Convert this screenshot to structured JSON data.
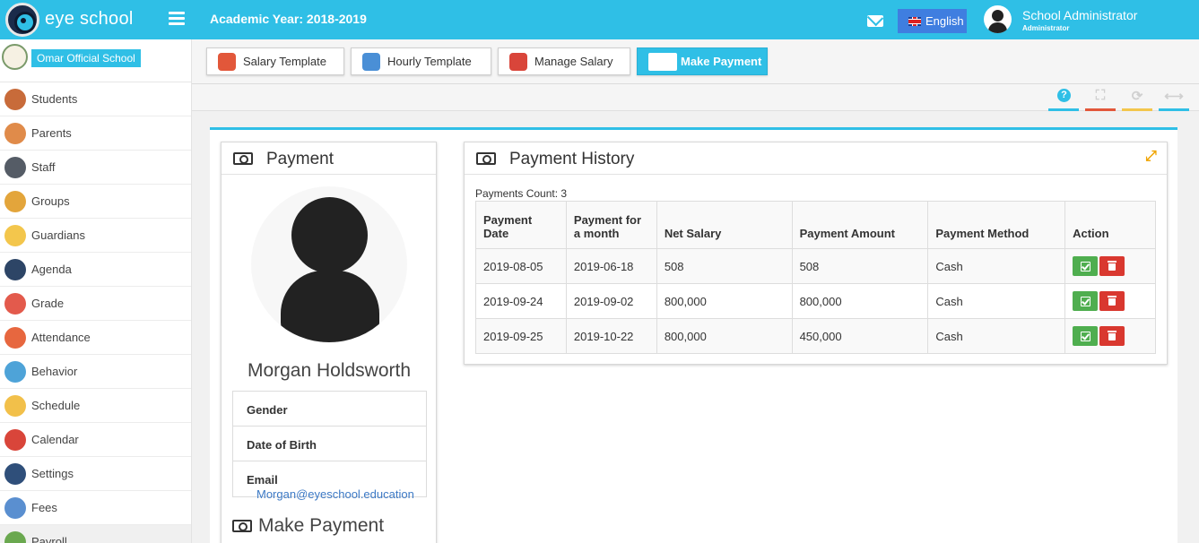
{
  "header": {
    "brand": "eye school",
    "academic_year": "Academic Year: 2018-2019",
    "language": "English",
    "user_name": "School Administrator",
    "user_role": "Administrator"
  },
  "sidebar": {
    "school_name": "Omar Official School",
    "items": [
      {
        "label": "Students",
        "icon": "students-icon",
        "color": "#c86b3a"
      },
      {
        "label": "Parents",
        "icon": "parents-icon",
        "color": "#e08b4a"
      },
      {
        "label": "Staff",
        "icon": "staff-icon",
        "color": "#555c66"
      },
      {
        "label": "Groups",
        "icon": "groups-icon",
        "color": "#e3a53b"
      },
      {
        "label": "Guardians",
        "icon": "guardians-icon",
        "color": "#f3c64c"
      },
      {
        "label": "Agenda",
        "icon": "agenda-icon",
        "color": "#2d4566"
      },
      {
        "label": "Grade",
        "icon": "grade-icon",
        "color": "#e35a4c"
      },
      {
        "label": "Attendance",
        "icon": "attendance-icon",
        "color": "#e7673f"
      },
      {
        "label": "Behavior",
        "icon": "behavior-icon",
        "color": "#4ea3d8"
      },
      {
        "label": "Schedule",
        "icon": "schedule-icon",
        "color": "#f2c04a"
      },
      {
        "label": "Calendar",
        "icon": "calendar-icon",
        "color": "#d9453a"
      },
      {
        "label": "Settings",
        "icon": "settings-icon",
        "color": "#2f4f7a"
      },
      {
        "label": "Fees",
        "icon": "fees-icon",
        "color": "#5a8fd0"
      },
      {
        "label": "Payroll",
        "icon": "payroll-icon",
        "color": "#6aa84f"
      }
    ]
  },
  "tabs": [
    {
      "label": "Salary Template",
      "icon": "salary-template-icon",
      "color": "#e2573a"
    },
    {
      "label": "Hourly Template",
      "icon": "hourly-template-icon",
      "color": "#4a8fd6"
    },
    {
      "label": "Manage Salary",
      "icon": "manage-salary-icon",
      "color": "#d9453a"
    },
    {
      "label": "Make Payment",
      "icon": "make-payment-icon",
      "color": "#e6b83a"
    }
  ],
  "toolbar": {
    "help": "?",
    "tools": [
      {
        "icon": "help-icon",
        "color": "#2fbfe6"
      },
      {
        "icon": "fullscreen-icon",
        "color": "#e2573a"
      },
      {
        "icon": "refresh-icon",
        "color": "#f3c64c"
      },
      {
        "icon": "resize-icon",
        "color": "#2fbfe6"
      }
    ]
  },
  "payment_card": {
    "title": "Payment",
    "employee_name": "Morgan Holdsworth",
    "fields": {
      "gender": "Gender",
      "dob": "Date of Birth",
      "email": "Email"
    },
    "email_value": "Morgan@eyeschool.education",
    "make_payment": "Make Payment"
  },
  "history_card": {
    "title": "Payment History",
    "count_text": "Payments Count: 3",
    "columns": [
      "Payment Date",
      "Payment for a month",
      "Net Salary",
      "Payment Amount",
      "Payment Method",
      "Action"
    ],
    "rows": [
      {
        "date": "2019-08-05",
        "month": "2019-06-18",
        "net": "508",
        "amount": "508",
        "method": "Cash"
      },
      {
        "date": "2019-09-24",
        "month": "2019-09-02",
        "net": "800,000",
        "amount": "800,000",
        "method": "Cash"
      },
      {
        "date": "2019-09-25",
        "month": "2019-10-22",
        "net": "800,000",
        "amount": "450,000",
        "method": "Cash"
      }
    ]
  }
}
